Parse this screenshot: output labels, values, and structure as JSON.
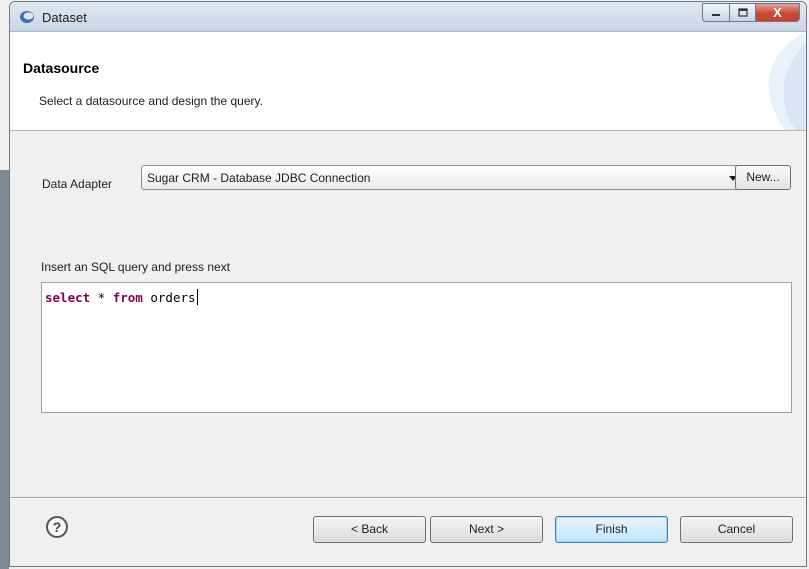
{
  "window": {
    "title": "Dataset",
    "controls": {
      "minimize": "minimize",
      "maximize": "maximize",
      "close": "X"
    }
  },
  "header": {
    "title": "Datasource",
    "description": "Select a datasource and design the query."
  },
  "adapter": {
    "label": "Data Adapter",
    "selected": "Sugar CRM - Database JDBC Connection",
    "new_button": "New..."
  },
  "query": {
    "label": "Insert an SQL query and press next",
    "tokens": {
      "kw1": "select",
      "t1": " * ",
      "kw2": "from",
      "t2": " orders"
    }
  },
  "footer": {
    "help": "?",
    "back": "< Back",
    "next": "Next >",
    "finish": "Finish",
    "cancel": "Cancel"
  },
  "icons": {
    "app": "eclipse-swoosh-icon",
    "help": "help-circle-icon",
    "dropdown": "chevron-down-icon"
  },
  "colors": {
    "sql_keyword": "#7f0055",
    "default_button_border": "#3c7fb1",
    "close_button": "#c74a35"
  }
}
